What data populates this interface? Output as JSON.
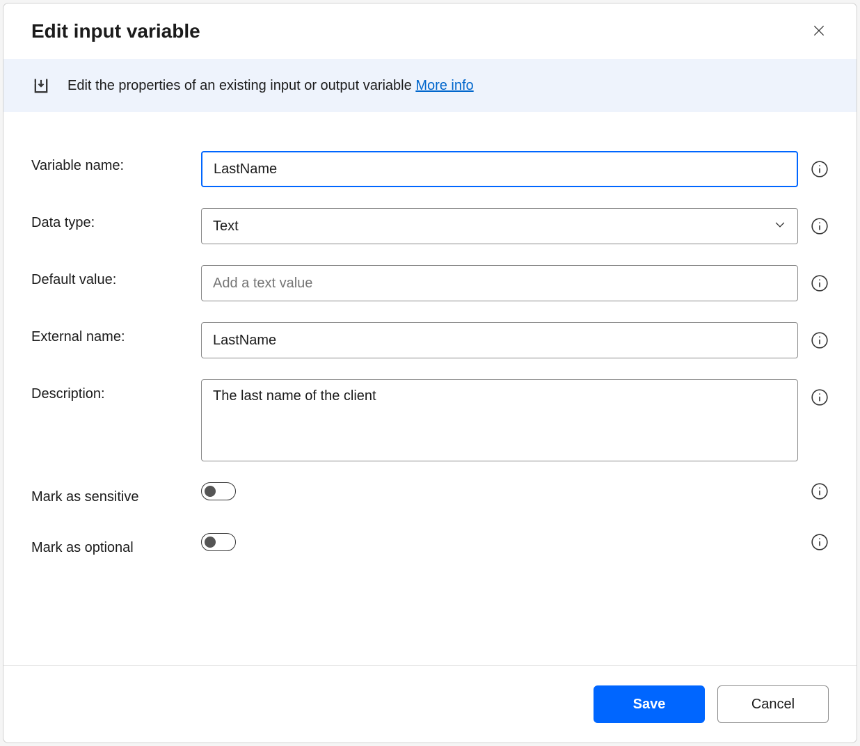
{
  "dialog": {
    "title": "Edit input variable",
    "banner": {
      "text": "Edit the properties of an existing input or output variable ",
      "linkText": "More info"
    }
  },
  "form": {
    "variableName": {
      "label": "Variable name:",
      "value": "LastName"
    },
    "dataType": {
      "label": "Data type:",
      "value": "Text"
    },
    "defaultValue": {
      "label": "Default value:",
      "value": "",
      "placeholder": "Add a text value"
    },
    "externalName": {
      "label": "External name:",
      "value": "LastName"
    },
    "description": {
      "label": "Description:",
      "value": "The last name of the client"
    },
    "markSensitive": {
      "label": "Mark as sensitive",
      "value": false
    },
    "markOptional": {
      "label": "Mark as optional",
      "value": false
    }
  },
  "buttons": {
    "save": "Save",
    "cancel": "Cancel"
  }
}
